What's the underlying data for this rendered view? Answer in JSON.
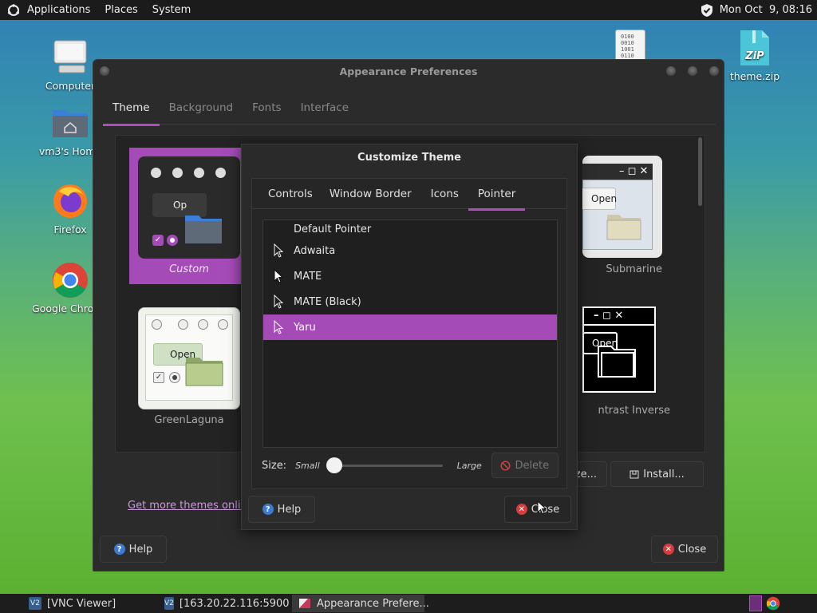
{
  "top_panel": {
    "menus": [
      "Applications",
      "Places",
      "System"
    ],
    "clock": "Mon Oct  9, 08:16"
  },
  "desktop": {
    "icons": [
      {
        "label": "Computer",
        "icon": "computer-icon"
      },
      {
        "label": "vm3's Home",
        "icon": "home-folder-icon"
      },
      {
        "label": "Firefox",
        "icon": "firefox-icon"
      },
      {
        "label": "Google Chrome",
        "icon": "chrome-icon"
      },
      {
        "label": "theme.zip",
        "icon": "zip-archive-icon"
      }
    ],
    "binary_file_text": "0100\n0010\n1001\n0110"
  },
  "main_window": {
    "title": "Appearance Preferences",
    "tabs": [
      "Theme",
      "Background",
      "Fonts",
      "Interface"
    ],
    "active_tab": "Theme",
    "themes": [
      {
        "name": "Custom",
        "selected": true
      },
      {
        "name": "Submarine",
        "selected": false
      },
      {
        "name": "GreenLaguna",
        "selected": false
      },
      {
        "name": "ntrast Inverse",
        "selected": false
      }
    ],
    "thumb_text": {
      "custom_open": "Op",
      "green_open": "Open",
      "submarine_open": "Open",
      "contrast_open": "Open"
    },
    "customize_label_partial": "ze...",
    "install_label": "Install...",
    "get_more_link": "Get more themes online",
    "help_label": "Help",
    "close_label": "Close"
  },
  "dialog": {
    "title": "Customize Theme",
    "tabs": [
      "Controls",
      "Window Border",
      "Icons",
      "Pointer"
    ],
    "active_tab": "Pointer",
    "pointers": [
      {
        "name": "Default Pointer",
        "icon": "none"
      },
      {
        "name": "Adwaita",
        "icon": "arrow-pointer-outline-icon"
      },
      {
        "name": "MATE",
        "icon": "arrow-pointer-white-icon"
      },
      {
        "name": "MATE (Black)",
        "icon": "arrow-pointer-outline-icon"
      },
      {
        "name": "Yaru",
        "icon": "arrow-pointer-outline-icon"
      }
    ],
    "selected_pointer": "Yaru",
    "size_label": "Size:",
    "size_small": "Small",
    "size_large": "Large",
    "size_value_fraction": 0.0,
    "delete_label": "Delete",
    "help_label": "Help",
    "close_label": "Close"
  },
  "taskbar": {
    "tasks": [
      {
        "label": "[VNC Viewer]",
        "icon": "vnc-icon"
      },
      {
        "label": "[163.20.22.116:5900 ...",
        "icon": "vnc-icon"
      },
      {
        "label": "Appearance Prefere...",
        "icon": "appearance-icon",
        "active": true
      }
    ]
  },
  "colors": {
    "accent": "#a54bb8",
    "panel": "#1b1b1b",
    "window_bg": "#2b2b2b"
  }
}
